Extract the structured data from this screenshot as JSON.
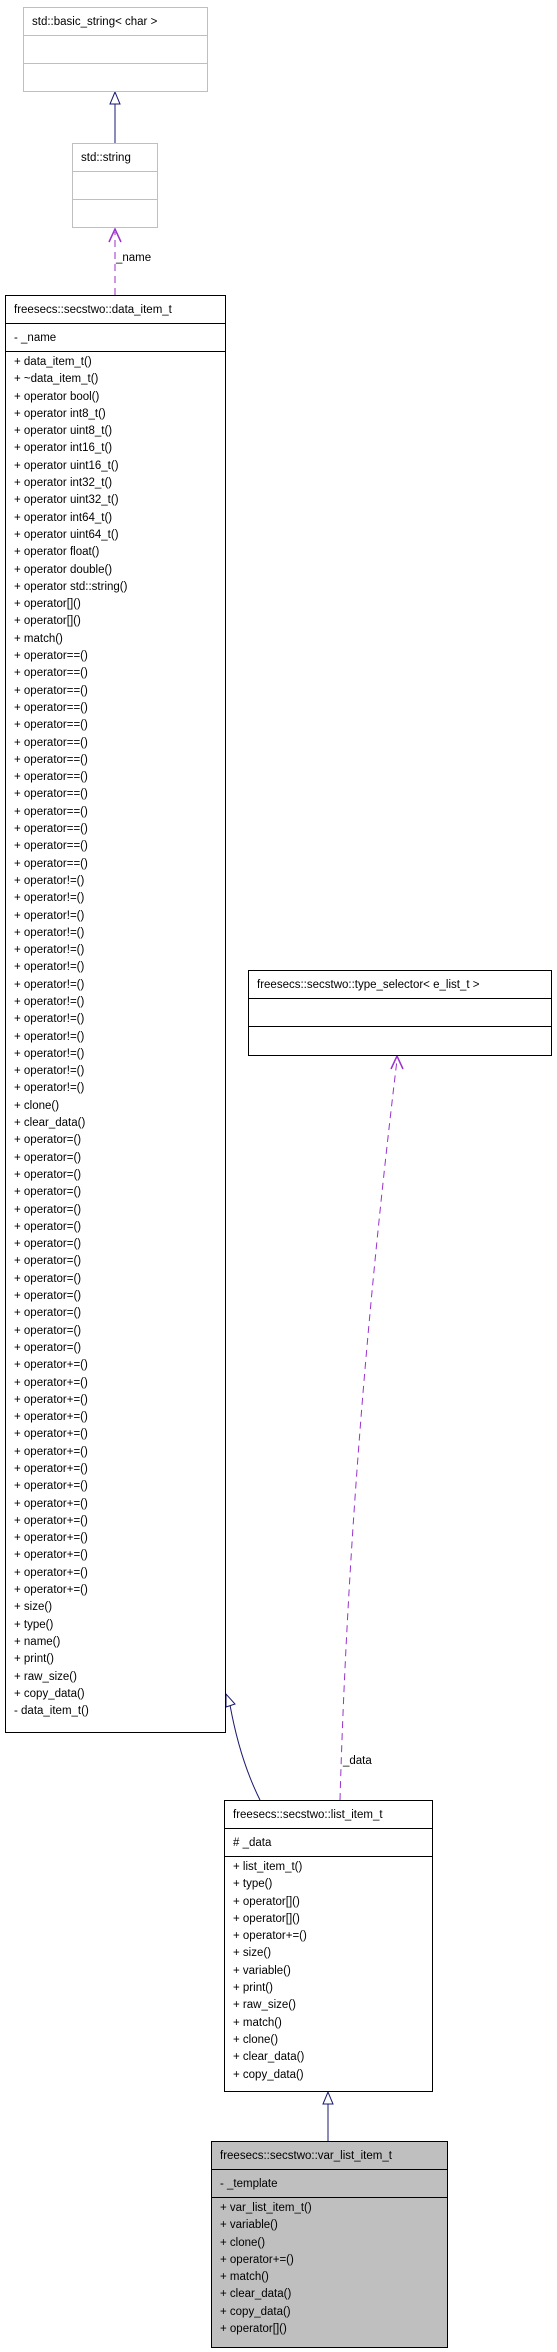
{
  "classes": {
    "basic_string": {
      "name": "std::basic_string< char >",
      "attributes": [],
      "methods": []
    },
    "string": {
      "name": "std::string",
      "attributes": [],
      "methods": []
    },
    "data_item_t": {
      "name": "freesecs::secstwo::data_item_t",
      "attributes": [
        "- _name"
      ],
      "methods": [
        "+ data_item_t()",
        "+ ~data_item_t()",
        "+ operator bool()",
        "+ operator int8_t()",
        "+ operator uint8_t()",
        "+ operator int16_t()",
        "+ operator uint16_t()",
        "+ operator int32_t()",
        "+ operator uint32_t()",
        "+ operator int64_t()",
        "+ operator uint64_t()",
        "+ operator float()",
        "+ operator double()",
        "+ operator std::string()",
        "+ operator[]()",
        "+ operator[]()",
        "+ match()",
        "+ operator==()",
        "+ operator==()",
        "+ operator==()",
        "+ operator==()",
        "+ operator==()",
        "+ operator==()",
        "+ operator==()",
        "+ operator==()",
        "+ operator==()",
        "+ operator==()",
        "+ operator==()",
        "+ operator==()",
        "+ operator==()",
        "+ operator!=()",
        "+ operator!=()",
        "+ operator!=()",
        "+ operator!=()",
        "+ operator!=()",
        "+ operator!=()",
        "+ operator!=()",
        "+ operator!=()",
        "+ operator!=()",
        "+ operator!=()",
        "+ operator!=()",
        "+ operator!=()",
        "+ operator!=()",
        "+ clone()",
        "+ clear_data()",
        "+ operator=()",
        "+ operator=()",
        "+ operator=()",
        "+ operator=()",
        "+ operator=()",
        "+ operator=()",
        "+ operator=()",
        "+ operator=()",
        "+ operator=()",
        "+ operator=()",
        "+ operator=()",
        "+ operator=()",
        "+ operator=()",
        "+ operator+=()",
        "+ operator+=()",
        "+ operator+=()",
        "+ operator+=()",
        "+ operator+=()",
        "+ operator+=()",
        "+ operator+=()",
        "+ operator+=()",
        "+ operator+=()",
        "+ operator+=()",
        "+ operator+=()",
        "+ operator+=()",
        "+ operator+=()",
        "+ operator+=()",
        "+ size()",
        "+ type()",
        "+ name()",
        "+ print()",
        "+ raw_size()",
        "+ copy_data()",
        "- data_item_t()"
      ]
    },
    "type_selector": {
      "name": "freesecs::secstwo::type_selector< e_list_t >",
      "attributes": [],
      "methods": []
    },
    "list_item_t": {
      "name": "freesecs::secstwo::list_item_t",
      "attributes": [
        "# _data"
      ],
      "methods": [
        "+ list_item_t()",
        "+ type()",
        "+ operator[]()",
        "+ operator[]()",
        "+ operator+=()",
        "+ size()",
        "+ variable()",
        "+ print()",
        "+ raw_size()",
        "+ match()",
        "+ clone()",
        "+ clear_data()",
        "+ copy_data()"
      ]
    },
    "var_list_item_t": {
      "name": "freesecs::secstwo::var_list_item_t",
      "attributes": [
        "- _template"
      ],
      "methods": [
        "+ var_list_item_t()",
        "+ variable()",
        "+ clone()",
        "+ operator+=()",
        "+ match()",
        "+ clear_data()",
        "+ copy_data()",
        "+ operator[]()"
      ]
    }
  },
  "relations": {
    "name_label": "_name",
    "data_label": "_data"
  },
  "colors": {
    "inheritance": "#191970",
    "usage": "#9a32cd",
    "external_border": "#bfbfbf",
    "current_fill": "#bfbfbf"
  }
}
